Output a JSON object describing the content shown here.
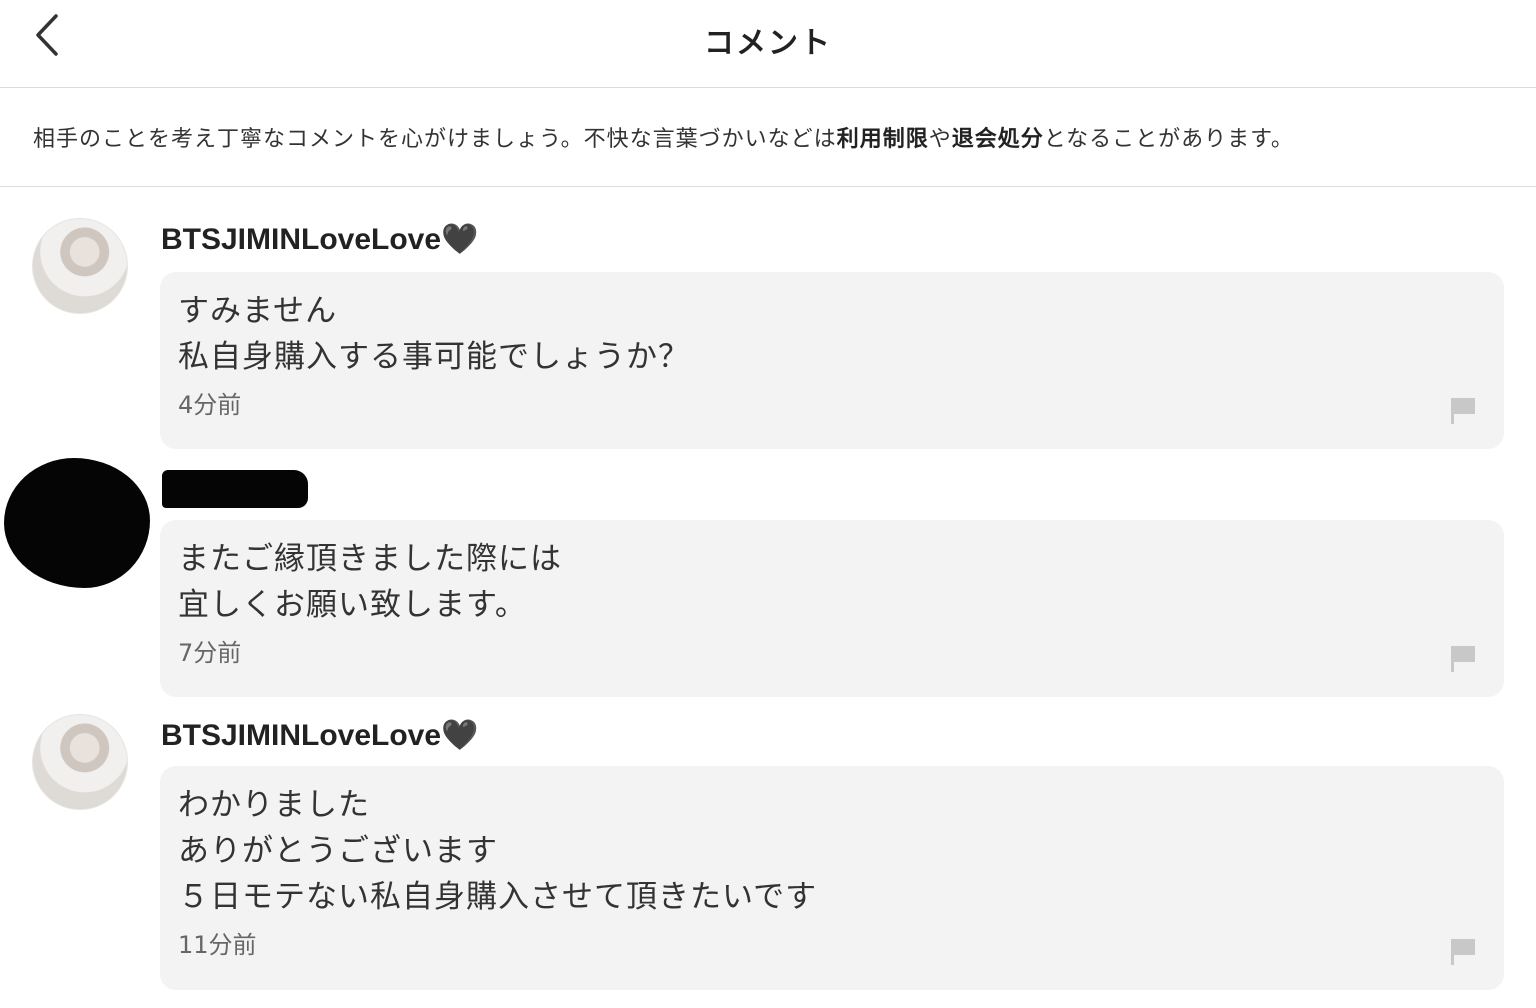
{
  "header": {
    "title": "コメント"
  },
  "notice": {
    "text_before": "相手のことを考え丁寧なコメントを心がけましょう。不快な言葉づかいなどは",
    "bold_1": "利用制限",
    "text_middle": "や",
    "bold_2": "退会処分",
    "text_after": "となることがあります。"
  },
  "comments": [
    {
      "username": "BTSJIMINLoveLove🖤",
      "lines": [
        "すみません",
        "私自身購入する事可能でしょうか？"
      ],
      "time": "4分前"
    },
    {
      "username": "",
      "lines": [
        "またご縁頂きました際には",
        "宜しくお願い致します。"
      ],
      "time": "7分前"
    },
    {
      "username": "BTSJIMINLoveLove🖤",
      "lines": [
        "わかりました",
        "ありがとうございます",
        "５日モテない私自身購入させて頂きたいです"
      ],
      "time": "11分前"
    }
  ],
  "icons": {
    "back": "chevron-left-icon",
    "report": "flag-icon"
  },
  "colors": {
    "bubble_bg": "#f3f3f3",
    "divider": "#dcdcdc",
    "flag": "#c8c8c8"
  }
}
